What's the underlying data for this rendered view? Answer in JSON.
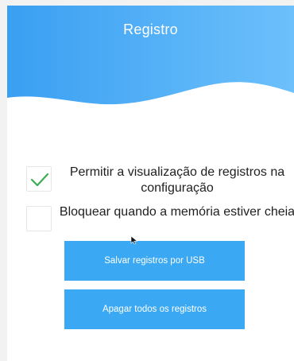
{
  "header": {
    "title": "Registro"
  },
  "options": [
    {
      "label": "Permitir a visualização de registros na configuração",
      "checked": true,
      "icon": "checkmark-icon"
    },
    {
      "label": "Bloquear quando a memória estiver cheia",
      "checked": false
    }
  ],
  "buttons": {
    "save_usb_label": "Salvar registros por USB",
    "delete_all_label": "Apagar todos os registros"
  },
  "colors": {
    "accent": "#3aa8f3",
    "checkmark": "#3dab55",
    "header_gradient_start": "#3a9ff2",
    "header_gradient_end": "#6cc0fb"
  }
}
